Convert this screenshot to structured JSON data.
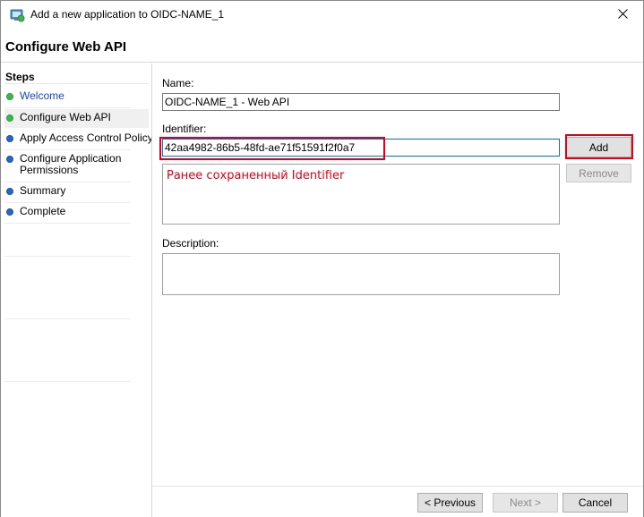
{
  "window": {
    "title": "Add a new application to OIDC-NAME_1",
    "close_symbol": "✕"
  },
  "header": {
    "title": "Configure Web API"
  },
  "steps": {
    "heading": "Steps",
    "items": [
      {
        "label": "Welcome",
        "status": "complete",
        "link": true
      },
      {
        "label": "Configure Web API",
        "status": "current",
        "link": false
      },
      {
        "label": "Apply Access Control Policy",
        "status": "pending",
        "link": false
      },
      {
        "label_line1": "Configure Application",
        "label_line2": "Permissions",
        "status": "pending",
        "link": false
      },
      {
        "label": "Summary",
        "status": "pending",
        "link": false
      },
      {
        "label": "Complete",
        "status": "pending",
        "link": false
      }
    ]
  },
  "form": {
    "name_label": "Name:",
    "name_value": "OIDC-NAME_1 - Web API",
    "identifier_label": "Identifier:",
    "identifier_value": "42aa4982-86b5-48fd-ae71f51591f2f0a7",
    "identifier_annotation": "Ранее сохраненный Identifier",
    "add_button": "Add",
    "remove_button": "Remove",
    "description_label": "Description:",
    "description_value": ""
  },
  "footer": {
    "previous_button": "< Previous",
    "next_button": "Next >",
    "cancel_button": "Cancel"
  },
  "colors": {
    "annotation": "#e0001a",
    "step_complete": "#3bb84a",
    "step_pending": "#2a66c9",
    "link": "#1a45c8"
  },
  "icons": {
    "app": "adfs-application-icon",
    "close": "close-icon"
  }
}
